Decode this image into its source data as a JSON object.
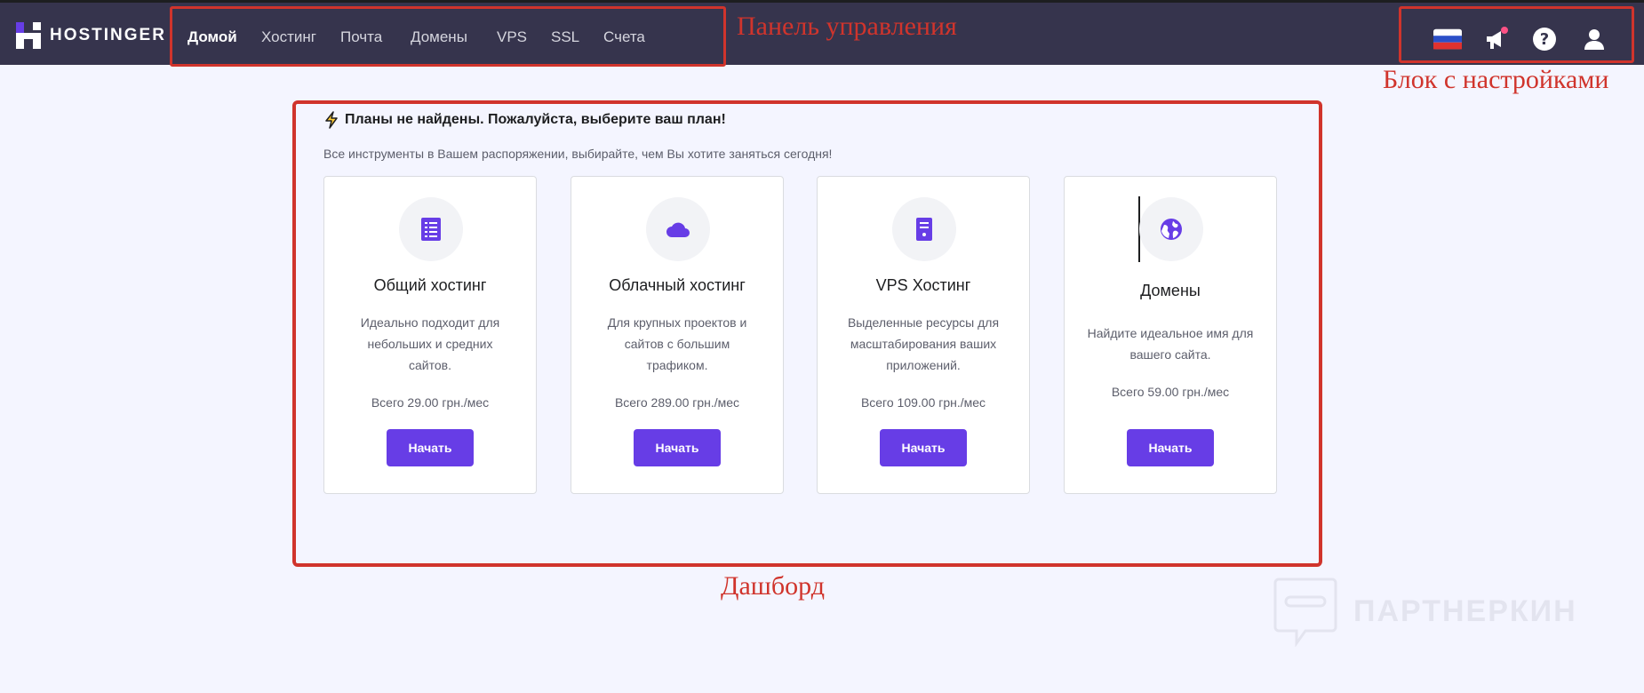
{
  "brand": {
    "name": "HOSTINGER"
  },
  "nav": {
    "items": [
      {
        "label": "Домой",
        "active": true
      },
      {
        "label": "Хостинг",
        "active": false
      },
      {
        "label": "Почта",
        "active": false
      },
      {
        "label": "Домены",
        "active": false
      },
      {
        "label": "VPS",
        "active": false
      },
      {
        "label": "SSL",
        "active": false
      },
      {
        "label": "Счета",
        "active": false
      }
    ]
  },
  "annotations": {
    "nav": "Панель управления",
    "settings": "Блок с настройками",
    "dashboard": "Дашборд"
  },
  "settings_icons": [
    "russia-flag-icon",
    "megaphone-icon",
    "help-icon",
    "user-icon"
  ],
  "dashboard": {
    "title": "Планы не найдены. Пожалуйста, выберите ваш план!",
    "subtitle": "Все инструменты в Вашем распоряжении, выбирайте, чем Вы хотите заняться сегодня!",
    "cards": [
      {
        "icon": "server-list-icon",
        "title": "Общий хостинг",
        "description": "Идеально подходит для небольших и средних сайтов.",
        "price": "Всего 29.00 грн./мес",
        "button": "Начать"
      },
      {
        "icon": "cloud-icon",
        "title": "Облачный хостинг",
        "description": "Для крупных проектов и сайтов с большим трафиком.",
        "price": "Всего 289.00 грн./мес",
        "button": "Начать"
      },
      {
        "icon": "vps-server-icon",
        "title": "VPS Хостинг",
        "description": "Выделенные ресурсы для масштабирования ваших приложений.",
        "price": "Всего 109.00 грн./мес",
        "button": "Начать"
      },
      {
        "icon": "globe-icon",
        "title": "Домены",
        "description": "Найдите идеальное имя для вашего сайта.",
        "price": "Всего 59.00 грн./мес",
        "button": "Начать"
      }
    ]
  },
  "watermark": {
    "text": "ПАРТНЕРКИН"
  },
  "colors": {
    "topbar": "#36344d",
    "accent": "#673de6",
    "annotation": "#d0342c",
    "background": "#f4f5ff"
  }
}
